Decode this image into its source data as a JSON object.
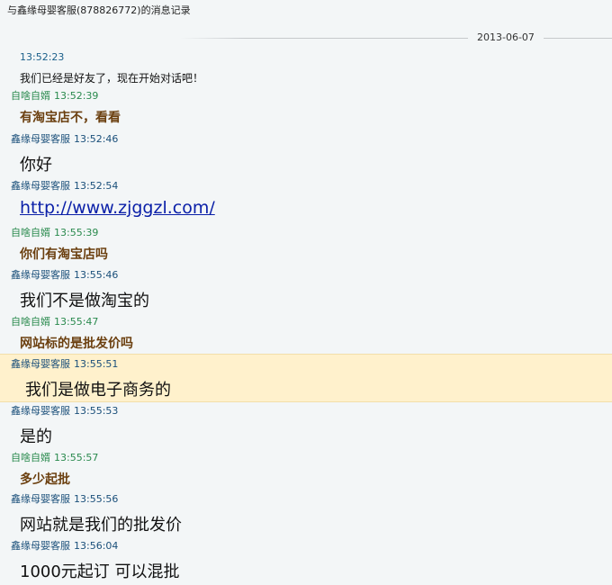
{
  "window": {
    "title": "与鑫缘母婴客服(878826772)的消息记录"
  },
  "date": "2013-06-07",
  "messages": [
    {
      "sender": "",
      "time": "13:52:23",
      "text": "我们已经是好友了，现在开始对话吧！"
    },
    {
      "sender": "自啥自婿",
      "time": "13:52:39",
      "text": "有淘宝店不，看看"
    },
    {
      "sender": "鑫缘母婴客服",
      "time": "13:52:46",
      "text": "你好"
    },
    {
      "sender": "鑫缘母婴客服",
      "time": "13:52:54",
      "text": "http://www.zjggzl.com/"
    },
    {
      "sender": "自啥自婿",
      "time": "13:55:39",
      "text": "你们有淘宝店吗"
    },
    {
      "sender": "鑫缘母婴客服",
      "time": "13:55:46",
      "text": "我们不是做淘宝的"
    },
    {
      "sender": "自啥自婿",
      "time": "13:55:47",
      "text": "网站标的是批发价吗"
    },
    {
      "sender": "鑫缘母婴客服",
      "time": "13:55:51",
      "text": "我们是做电子商务的"
    },
    {
      "sender": "鑫缘母婴客服",
      "time": "13:55:53",
      "text": "是的"
    },
    {
      "sender": "自啥自婿",
      "time": "13:55:57",
      "text": "多少起批"
    },
    {
      "sender": "鑫缘母婴客服",
      "time": "13:55:56",
      "text": "网站就是我们的批发价"
    },
    {
      "sender": "鑫缘母婴客服",
      "time": "13:56:04",
      "text": "1000元起订 可以混批"
    }
  ]
}
